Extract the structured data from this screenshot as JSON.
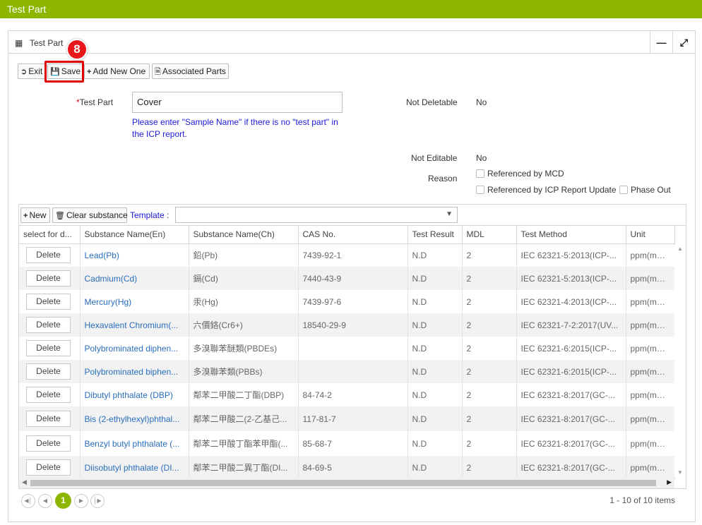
{
  "app": {
    "title": "Test Part"
  },
  "panel": {
    "title": "Test Part"
  },
  "toolbar": {
    "exit_label": "Exit",
    "save_label": "Save",
    "add_new_label": "Add New One",
    "associated_label": "Associated Parts",
    "step_badge": "8"
  },
  "form": {
    "test_part_label": "Test Part",
    "required_mark": "*",
    "test_part_value": "Cover",
    "hint": "Please enter \"Sample Name\" if there is no \"test part\" in the ICP report.",
    "not_deletable_label": "Not Deletable",
    "not_deletable_value": "No",
    "not_editable_label": "Not Editable",
    "not_editable_value": "No",
    "reason_label": "Reason",
    "reason_options": [
      "Referenced by MCD",
      "Referenced by ICP Report Update",
      "Phase Out"
    ]
  },
  "grid_toolbar": {
    "new_label": "New",
    "clear_label": "Clear substance",
    "template_label": "Template",
    "template_colon": ":",
    "template_value": ""
  },
  "grid": {
    "columns": [
      "select for d...",
      "Substance Name(En)",
      "Substance Name(Ch)",
      "CAS No.",
      "Test Result",
      "MDL",
      "Test Method",
      "Unit"
    ],
    "delete_label": "Delete",
    "rows": [
      {
        "en": "Lead(Pb)",
        "ch": "鉛(Pb)",
        "cas": "7439-92-1",
        "result": "N.D",
        "mdl": "2",
        "method": "IEC 62321-5:2013(ICP-...",
        "unit": "ppm(mg/..."
      },
      {
        "en": "Cadmium(Cd)",
        "ch": "鎘(Cd)",
        "cas": "7440-43-9",
        "result": "N.D",
        "mdl": "2",
        "method": "IEC 62321-5:2013(ICP-...",
        "unit": "ppm(mg/..."
      },
      {
        "en": "Mercury(Hg)",
        "ch": "汞(Hg)",
        "cas": "7439-97-6",
        "result": "N.D",
        "mdl": "2",
        "method": "IEC 62321-4:2013(ICP-...",
        "unit": "ppm(mg/..."
      },
      {
        "en": "Hexavalent Chromium(...",
        "ch": "六價鉻(Cr6+)",
        "cas": "18540-29-9",
        "result": "N.D",
        "mdl": "2",
        "method": "IEC 62321-7-2:2017(UV...",
        "unit": "ppm(mg/..."
      },
      {
        "en": "Polybrominated diphen...",
        "ch": "多溴聯苯醚類(PBDEs)",
        "cas": "",
        "result": "N.D",
        "mdl": "2",
        "method": "IEC 62321-6:2015(ICP-...",
        "unit": "ppm(mg/..."
      },
      {
        "en": "Polybrominated biphen...",
        "ch": "多溴聯苯類(PBBs)",
        "cas": "",
        "result": "N.D",
        "mdl": "2",
        "method": "IEC 62321-6:2015(ICP-...",
        "unit": "ppm(mg/..."
      },
      {
        "en": "Dibutyl phthalate (DBP)",
        "ch": "鄰苯二甲酸二丁酯(DBP)",
        "cas": "84-74-2",
        "result": "N.D",
        "mdl": "2",
        "method": "IEC 62321-8:2017(GC-...",
        "unit": "ppm(mg/..."
      },
      {
        "en": "Bis (2-ethylhexyl)phthal...",
        "ch": "鄰苯二甲酸二(2-乙基己...",
        "cas": "117-81-7",
        "result": "N.D",
        "mdl": "2",
        "method": "IEC 62321-8:2017(GC-...",
        "unit": "ppm(mg/..."
      },
      {
        "en": "Benzyl butyl phthalate (...",
        "ch": "鄰苯二甲酸丁酯苯甲酯(...",
        "cas": "85-68-7",
        "result": "N.D",
        "mdl": "2",
        "method": "IEC 62321-8:2017(GC-...",
        "unit": "ppm(mg/..."
      },
      {
        "en": "Diisobutyl phthalate (DI...",
        "ch": "鄰苯二甲酸二異丁酯(DI...",
        "cas": "84-69-5",
        "result": "N.D",
        "mdl": "2",
        "method": "IEC 62321-8:2017(GC-...",
        "unit": "ppm(mg/..."
      }
    ]
  },
  "pager": {
    "current_page": "1",
    "info": "1 - 10 of 10 items"
  },
  "colors": {
    "brand": "#8db600",
    "highlight": "#e00000",
    "link": "#2a6ebd",
    "hint": "#1a1ad6"
  },
  "icons": [
    "grid-icon",
    "minimize-icon",
    "expand-icon",
    "exit-icon",
    "save-icon",
    "plus-icon",
    "document-icon",
    "trash-icon",
    "dropdown-arrow-icon"
  ]
}
